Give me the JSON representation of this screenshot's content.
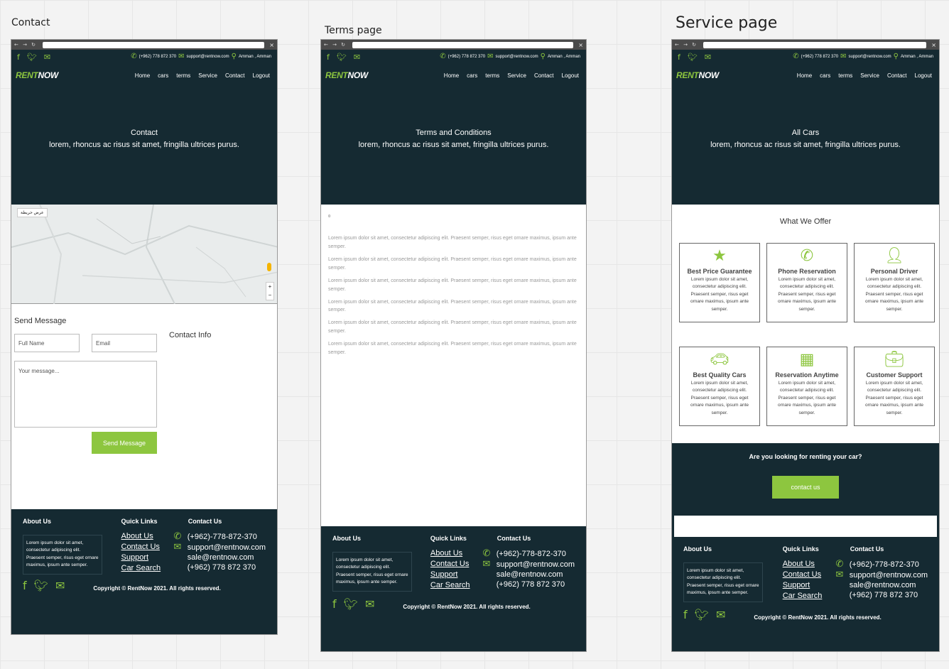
{
  "panels": {
    "contact": {
      "title": "Contact"
    },
    "terms": {
      "title": "Terms page"
    },
    "service": {
      "title": "Service page"
    }
  },
  "site": {
    "topbar": {
      "phone": "(+962) 778 872 370",
      "email": "support@rentnow.com",
      "location": "Amman , Amman"
    },
    "logo": {
      "part1": "RENT",
      "part2": "NOW"
    },
    "menu": [
      "Home",
      "cars",
      "terms",
      "Service",
      "Contact",
      "Logout"
    ],
    "hero_subtitle": "lorem, rhoncus ac risus sit amet, fringilla ultrices purus.",
    "footer": {
      "about_heading": "About Us",
      "about_text": "Lorem ipsum dolor sit amet, consectetur adipiscing elit. Praesent semper, risus eget ornare maximus, ipsum ante semper.",
      "quick_heading": "Quick Links",
      "quick_links": [
        "About Us",
        "Contact Us",
        "Support",
        "Car Search"
      ],
      "contact_heading": "Contact Us",
      "contact_phone": "(+962)-778-872-370",
      "contact_email1": "support@rentnow.com",
      "contact_email2": "sale@rentnow.com",
      "contact_phone2": "(+962) 778 872 370",
      "copyright": "Copyright © RentNow 2021. All rights reserved."
    }
  },
  "contact_page": {
    "hero_title": "Contact",
    "map_tag": "عرض خريطة",
    "send_title": "Send Message",
    "name_placeholder": "Full Name",
    "email_placeholder": "Email",
    "message_placeholder": "Your message...",
    "send_button": "Send Message",
    "contact_info": "Contact Info"
  },
  "terms_page": {
    "hero_title": "Terms and Conditions",
    "marker": "¤",
    "paragraphs": [
      "Lorem ipsum dolor sit amet, consectetur adipiscing elit. Praesent semper, risus eget ornare maximus, ipsum ante semper.",
      "Lorem ipsum dolor sit amet, consectetur adipiscing elit. Praesent semper, risus eget ornare maximus, ipsum ante semper.",
      "Lorem ipsum dolor sit amet, consectetur adipiscing elit. Praesent semper, risus eget ornare maximus, ipsum ante semper.",
      "Lorem ipsum dolor sit amet, consectetur adipiscing elit. Praesent semper, risus eget ornare maximus, ipsum ante semper.",
      "Lorem ipsum dolor sit amet, consectetur adipiscing elit. Praesent semper, risus eget ornare maximus, ipsum ante semper.",
      "Lorem ipsum dolor sit amet, consectetur adipiscing elit. Praesent semper, risus eget ornare maximus, ipsum ante semper."
    ]
  },
  "service_page": {
    "hero_title": "All Cars",
    "offer_heading": "What We Offer",
    "cards": [
      {
        "title": "Best Price Guarantee",
        "icon": "star-icon",
        "text": "Lorem ipsum dolor sit amet, consectetur adipiscing elit. Praesent semper, risus eget ornare maximus, ipsum ante semper."
      },
      {
        "title": "Phone Reservation",
        "icon": "phone-icon",
        "text": "Lorem ipsum dolor sit amet, consectetur adipiscing elit. Praesent semper, risus eget ornare maximus, ipsum ante semper."
      },
      {
        "title": "Personal Driver",
        "icon": "driver-icon",
        "text": "Lorem ipsum dolor sit amet, consectetur adipiscing elit. Praesent semper, risus eget ornare maximus, ipsum ante semper."
      },
      {
        "title": "Best Quality Cars",
        "icon": "car-icon",
        "text": "Lorem ipsum dolor sit amet, consectetur adipiscing elit. Praesent semper, risus eget ornare maximus, ipsum ante semper."
      },
      {
        "title": "Reservation Anytime",
        "icon": "calendar-icon",
        "text": "Lorem ipsum dolor sit amet, consectetur adipiscing elit. Praesent semper, risus eget ornare maximus, ipsum ante semper."
      },
      {
        "title": "Customer Support",
        "icon": "briefcase-icon",
        "text": "Lorem ipsum dolor sit amet, consectetur adipiscing elit. Praesent semper, risus eget ornare maximus, ipsum ante semper."
      }
    ],
    "cta_question": "Are you looking for renting your car?",
    "cta_button": "contact us"
  },
  "colors": {
    "dark": "#152a32",
    "accent": "#8dc63f"
  }
}
